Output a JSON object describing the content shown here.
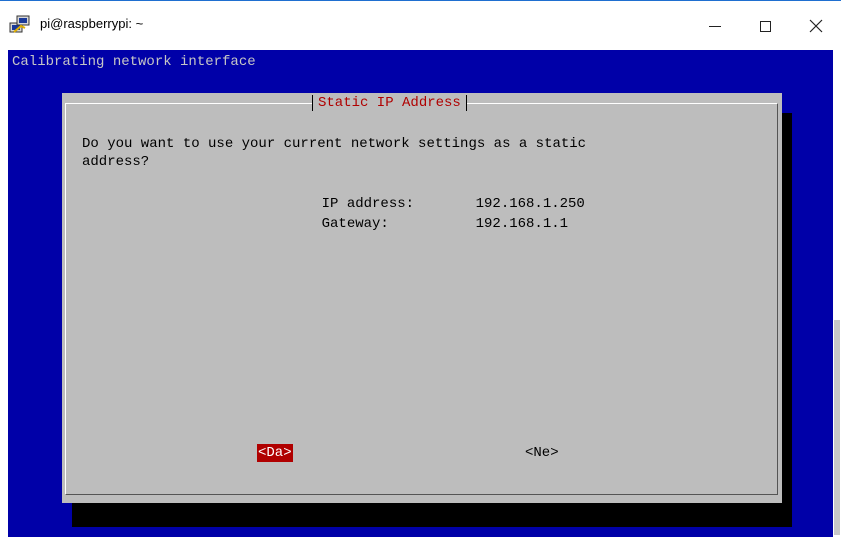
{
  "window": {
    "title": "pi@raspberrypi: ~",
    "icon": "putty-icon",
    "controls": [
      "minimize-icon",
      "maximize-icon",
      "close-icon"
    ]
  },
  "terminal": {
    "backtitle": "Calibrating network interface",
    "colors": {
      "background": "#0000a8",
      "dialog": "#bdbdbd",
      "accent": "#b00000"
    }
  },
  "dialog": {
    "title": "Static IP Address",
    "question": "Do you want to use your current network settings as a static\naddress?",
    "ip_label": "IP address:",
    "ip_value": "192.168.1.250",
    "gateway_label": "Gateway:",
    "gateway_value": "192.168.1.1",
    "yes_label": "<Da>",
    "no_label": "<Ne>"
  }
}
